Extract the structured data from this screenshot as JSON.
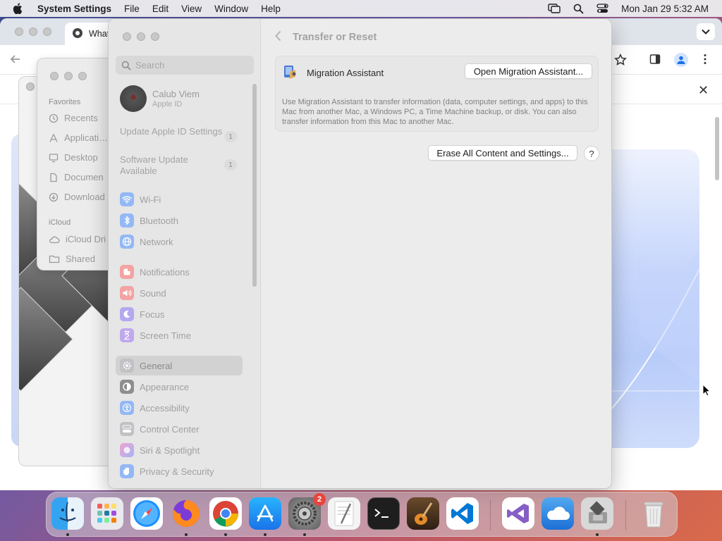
{
  "menubar": {
    "app_name": "System Settings",
    "menus": [
      "File",
      "Edit",
      "View",
      "Window",
      "Help"
    ],
    "datetime": "Mon Jan 29  5:32 AM",
    "icons": [
      "screen-mirroring-icon",
      "search-icon",
      "control-center-icon"
    ]
  },
  "chrome": {
    "tab_title": "What"
  },
  "finder": {
    "section_favorites": "Favorites",
    "section_icloud": "iCloud",
    "favorites": [
      "Recents",
      "Applicati…",
      "Desktop",
      "Documen",
      "Download"
    ],
    "icloud": [
      "iCloud Dri",
      "Shared"
    ]
  },
  "settings": {
    "search_placeholder": "Search",
    "profile": {
      "name": "Calub Viem",
      "subtitle": "Apple ID"
    },
    "notices": [
      {
        "text": "Update Apple ID Settings",
        "count": "1"
      },
      {
        "text": "Software Update Available",
        "count": "1"
      }
    ],
    "sidebar_items": [
      {
        "label": "Wi-Fi",
        "icon": "wifi-icon",
        "color": "#3b82f6"
      },
      {
        "label": "Bluetooth",
        "icon": "bluetooth-icon",
        "color": "#3b82f6"
      },
      {
        "label": "Network",
        "icon": "globe-icon",
        "color": "#3b82f6"
      },
      {
        "label": "Notifications",
        "icon": "bell-icon",
        "color": "#ef4444"
      },
      {
        "label": "Sound",
        "icon": "speaker-icon",
        "color": "#ef4444"
      },
      {
        "label": "Focus",
        "icon": "moon-icon",
        "color": "#6366f1"
      },
      {
        "label": "Screen Time",
        "icon": "hourglass-icon",
        "color": "#7c3aed"
      },
      {
        "label": "General",
        "icon": "gear-icon",
        "color": "#8e8e93",
        "selected": true
      },
      {
        "label": "Appearance",
        "icon": "appearance-icon",
        "color": "#1d1d1f"
      },
      {
        "label": "Accessibility",
        "icon": "accessibility-icon",
        "color": "#3b82f6"
      },
      {
        "label": "Control Center",
        "icon": "control-center-icon",
        "color": "#8e8e93"
      },
      {
        "label": "Siri & Spotlight",
        "icon": "siri-icon",
        "color": "#a855f7"
      },
      {
        "label": "Privacy & Security",
        "icon": "hand-icon",
        "color": "#3b82f6"
      }
    ],
    "page_title": "Transfer or Reset",
    "migration": {
      "title": "Migration Assistant",
      "button": "Open Migration Assistant...",
      "description": "Use Migration Assistant to transfer information (data, computer settings, and apps) to this Mac from another Mac, a Windows PC, a Time Machine backup, or disk. You can also transfer information from this Mac to another Mac."
    },
    "erase_button": "Erase All Content and Settings...",
    "help_label": "?"
  },
  "dock": {
    "apps": [
      "Finder",
      "Launchpad",
      "Safari",
      "Firefox",
      "Google Chrome",
      "App Store",
      "System Settings",
      "TextEdit",
      "Terminal",
      "GarageBand",
      "Visual Studio Code",
      "Visual Studio",
      "iCloud",
      "Boot Camp Assistant",
      "Trash"
    ],
    "settings_badge": "2"
  }
}
